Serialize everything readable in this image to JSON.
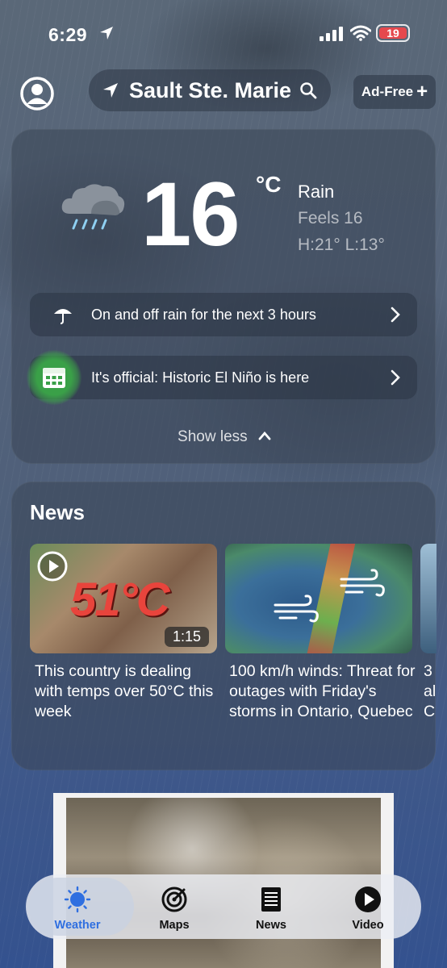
{
  "status_bar": {
    "time": "6:29",
    "battery": "19"
  },
  "header": {
    "location": "Sault Ste. Marie",
    "ad_free_label": "Ad-Free"
  },
  "weather": {
    "temperature": "16",
    "unit": "°C",
    "condition": "Rain",
    "feels_like": "Feels 16",
    "high_low": "H:21° L:13°",
    "alerts": [
      {
        "text": "On and off rain for the next 3 hours",
        "icon": "umbrella-icon"
      },
      {
        "text": "It's official: Historic El Niño is here",
        "icon": "calendar-icon"
      }
    ],
    "show_less_label": "Show less"
  },
  "news": {
    "title": "News",
    "items": [
      {
        "headline": "This country is dealing with temps over 50°C this week",
        "overlay_text": "51°C",
        "duration": "1:15"
      },
      {
        "headline": "100 km/h winds: Threat for outages with Friday's storms in Ontario, Quebec"
      },
      {
        "headline": "3\nal\nC"
      }
    ]
  },
  "tabs": [
    {
      "label": "Weather",
      "icon": "sun-icon",
      "active": true
    },
    {
      "label": "Maps",
      "icon": "radar-icon",
      "active": false
    },
    {
      "label": "News",
      "icon": "newspaper-icon",
      "active": false
    },
    {
      "label": "Video",
      "icon": "play-circle-icon",
      "active": false
    }
  ],
  "colors": {
    "accent": "#2f6fe0",
    "badge_green": "#3aa048",
    "battery_red": "#e5484d",
    "headline_red": "#e8443c"
  }
}
